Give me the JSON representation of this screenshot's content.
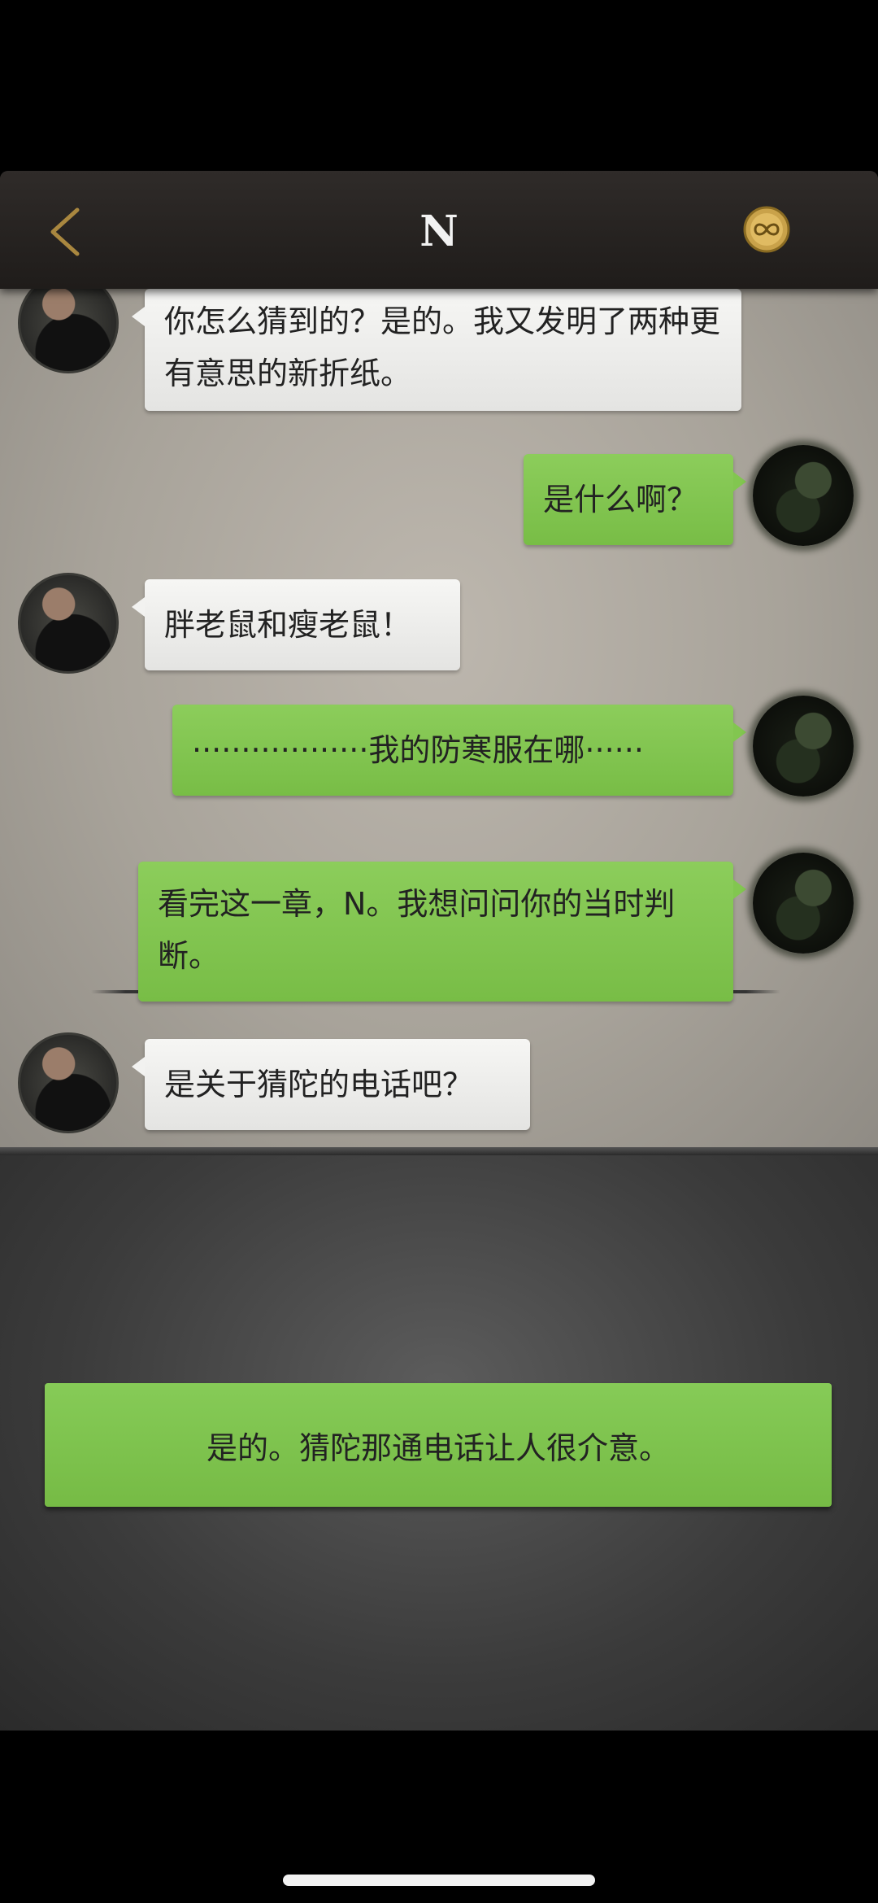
{
  "header": {
    "title": "N",
    "back_icon": "chevron-left-icon",
    "medal_icon": "infinity-medal-icon",
    "accent": "#b08a3a"
  },
  "messages": [
    {
      "side": "npc",
      "text": "你怎么猜到的？是的。我又发明了两种更有意思的新折纸。"
    },
    {
      "side": "me",
      "text": "是什么啊？"
    },
    {
      "side": "npc",
      "text": "胖老鼠和瘦老鼠！"
    },
    {
      "side": "me",
      "text": "··················我的防寒服在哪······"
    },
    {
      "side": "me",
      "text": "看完这一章，N。我想问问你的当时判断。"
    },
    {
      "side": "npc",
      "text": "是关于猜陀的电话吧？"
    }
  ],
  "choices": [
    {
      "label": "是的。猜陀那通电话让人很介意。"
    }
  ],
  "colors": {
    "npc_bubble": "#efefed",
    "me_bubble": "#82c650",
    "paper": "#aaa59c"
  }
}
